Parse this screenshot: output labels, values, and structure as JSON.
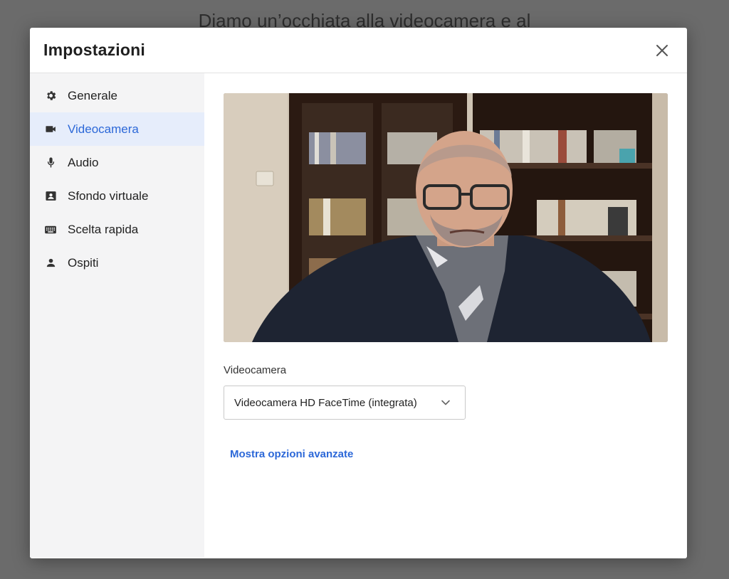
{
  "background": {
    "title": "Diamo un’occhiata alla videocamera e al"
  },
  "dialog": {
    "title": "Impostazioni"
  },
  "sidebar": {
    "items": [
      {
        "label": "Generale",
        "icon": "gear-icon",
        "active": false
      },
      {
        "label": "Videocamera",
        "icon": "video-camera-icon",
        "active": true
      },
      {
        "label": "Audio",
        "icon": "microphone-icon",
        "active": false
      },
      {
        "label": "Sfondo virtuale",
        "icon": "portrait-icon",
        "active": false
      },
      {
        "label": "Scelta rapida",
        "icon": "keyboard-icon",
        "active": false
      },
      {
        "label": "Ospiti",
        "icon": "person-icon",
        "active": false
      }
    ]
  },
  "camera": {
    "field_label": "Videocamera",
    "selected": "Videocamera HD FaceTime (integrata)",
    "advanced_link": "Mostra opzioni avanzate"
  },
  "colors": {
    "accent": "#2c68d8",
    "active_bg": "#e6edfb",
    "sidebar_bg": "#f4f4f5",
    "overlay": "#6b6b6b"
  }
}
